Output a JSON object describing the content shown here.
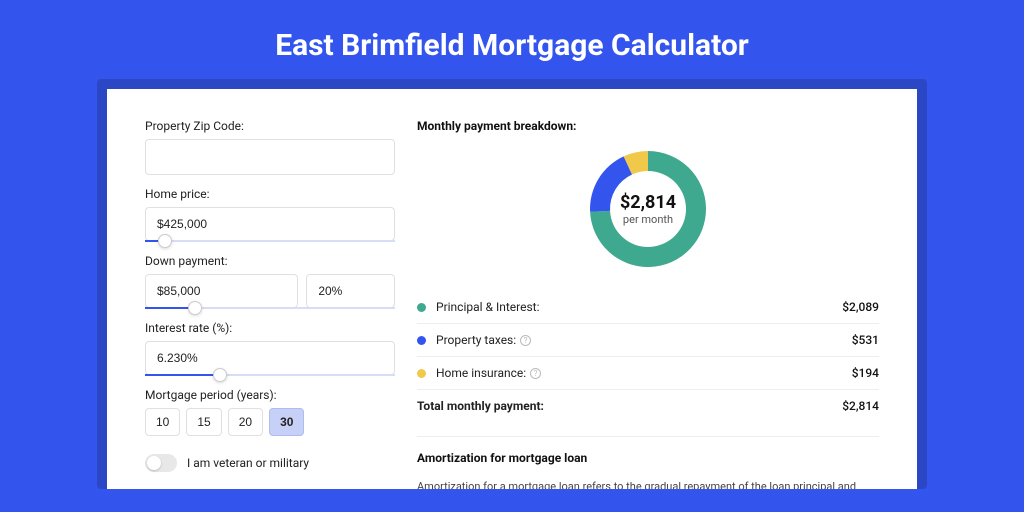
{
  "title": "East Brimfield Mortgage Calculator",
  "form": {
    "zip_label": "Property Zip Code:",
    "zip_value": "",
    "home_price_label": "Home price:",
    "home_price_value": "$425,000",
    "home_price_pct": 8,
    "down_payment_label": "Down payment:",
    "down_payment_value": "$85,000",
    "down_payment_pct_value": "20%",
    "down_payment_slider_pct": 20,
    "interest_label": "Interest rate (%):",
    "interest_value": "6.230%",
    "interest_slider_pct": 30,
    "period_label": "Mortgage period (years):",
    "periods": [
      "10",
      "15",
      "20",
      "30"
    ],
    "period_selected": "30",
    "veteran_label": "I am veteran or military"
  },
  "breakdown": {
    "heading": "Monthly payment breakdown:",
    "center_amount": "$2,814",
    "center_sub": "per month",
    "items": [
      {
        "color": "green",
        "label": "Principal & Interest:",
        "value": "$2,089",
        "info": false
      },
      {
        "color": "blue",
        "label": "Property taxes:",
        "value": "$531",
        "info": true
      },
      {
        "color": "yellow",
        "label": "Home insurance:",
        "value": "$194",
        "info": true
      }
    ],
    "total_label": "Total monthly payment:",
    "total_value": "$2,814"
  },
  "chart_data": {
    "type": "pie",
    "title": "Monthly payment breakdown",
    "series": [
      {
        "name": "Principal & Interest",
        "value": 2089,
        "color": "#3fa98f"
      },
      {
        "name": "Property taxes",
        "value": 531,
        "color": "#3355ee"
      },
      {
        "name": "Home insurance",
        "value": 194,
        "color": "#f0c94a"
      }
    ],
    "total": 2814
  },
  "amortization": {
    "heading": "Amortization for mortgage loan",
    "text": "Amortization for a mortgage loan refers to the gradual repayment of the loan principal and interest over a specified"
  }
}
